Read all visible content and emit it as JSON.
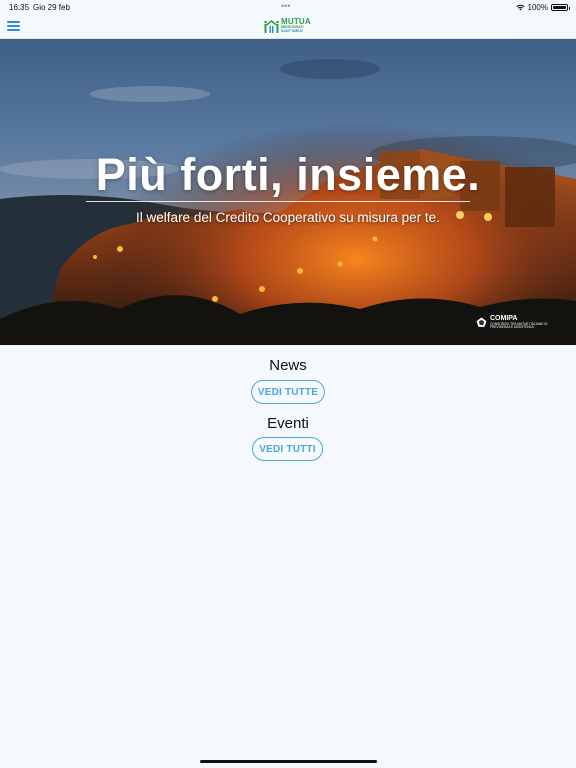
{
  "status_bar": {
    "time": "16:35",
    "date": "Gio 29 feb",
    "dots": "•••",
    "battery": "100%"
  },
  "header": {
    "logo": {
      "title": "MUTUA",
      "line1": "MEDIOCRATI",
      "line2": "SANT'UMILE"
    }
  },
  "hero": {
    "title": "Più forti, insieme.",
    "subtitle": "Il welfare del Credito Cooperativo su misura per te.",
    "badge_name": "COMIPA",
    "badge_tagline": "CONSORZIO TRA MUTUE ITALIANE DI PREVIDENZA E ASSISTENZA"
  },
  "sections": {
    "news": {
      "heading": "News",
      "button": "VEDI TUTTE"
    },
    "events": {
      "heading": "Eventi",
      "button": "VEDI TUTTI"
    }
  },
  "colors": {
    "accent": "#4aa9d6",
    "menu": "#2f8fc9",
    "brand_green": "#2e9e4a",
    "background": "#f5f8fc"
  },
  "icons": {
    "menu": "hamburger-menu-icon",
    "wifi": "wifi-icon",
    "battery": "battery-icon"
  }
}
